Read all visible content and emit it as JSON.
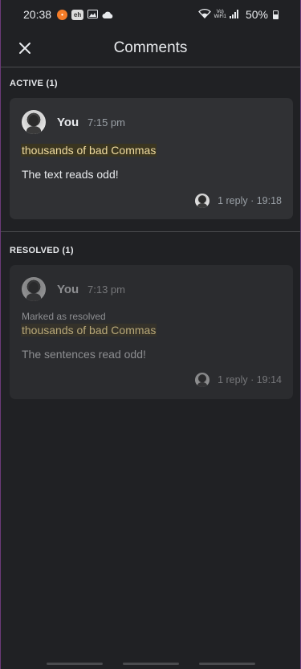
{
  "status_bar": {
    "time": "20:38",
    "network_label_top": "Vo)",
    "network_label_bottom": "WiFi1",
    "battery": "50%"
  },
  "app_bar": {
    "title": "Comments"
  },
  "active": {
    "header": "ACTIVE (1)",
    "comment": {
      "author": "You",
      "time": "7:15 pm",
      "quote": "thousands of bad Commas",
      "text": "The text reads odd!",
      "reply_info": "1 reply · 19:18"
    }
  },
  "resolved": {
    "header": "RESOLVED (1)",
    "comment": {
      "author": "You",
      "time": "7:13 pm",
      "status": "Marked as resolved",
      "quote": "thousands of bad Commas",
      "text": "The sentences read odd!",
      "reply_info": "1 reply · 19:14"
    }
  },
  "colors": {
    "background": "#202124",
    "card": "#303134",
    "quote_highlight": "#f0dca0"
  }
}
